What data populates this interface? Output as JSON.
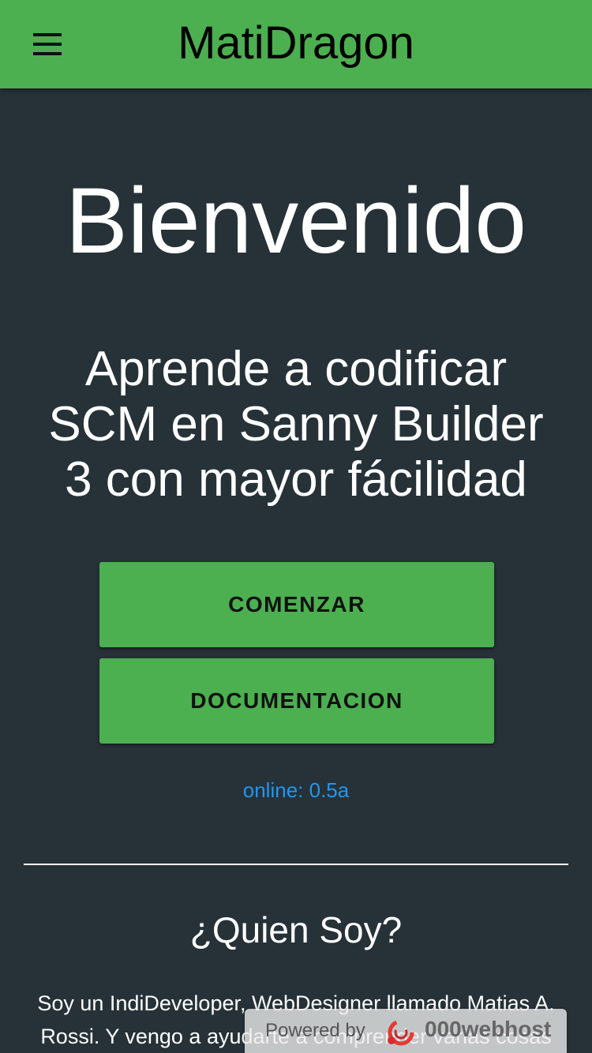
{
  "header": {
    "title": "MatiDragon",
    "menu_icon": "hamburger-menu-icon"
  },
  "hero": {
    "welcome": "Bienvenido",
    "tagline": "Aprende a codificar SCM en Sanny Builder 3 con mayor fácilidad"
  },
  "buttons": {
    "start_label": "COMENZAR",
    "docs_label": "DOCUMENTACION"
  },
  "status": {
    "online_text": "online: 0.5a"
  },
  "about": {
    "title": "¿Quien Soy?",
    "text": "Soy un IndiDeveloper, WebDesigner llamado Matias A. Rossi. Y vengo a ayudarte a comprender varias cosas"
  },
  "badge": {
    "powered_text": "Powered by",
    "brand_text": "000webhost",
    "logo_icon": "000webhost-logo-icon"
  },
  "colors": {
    "primary": "#4caf50",
    "background": "#263238",
    "link": "#2196f3",
    "text": "#ffffff"
  }
}
